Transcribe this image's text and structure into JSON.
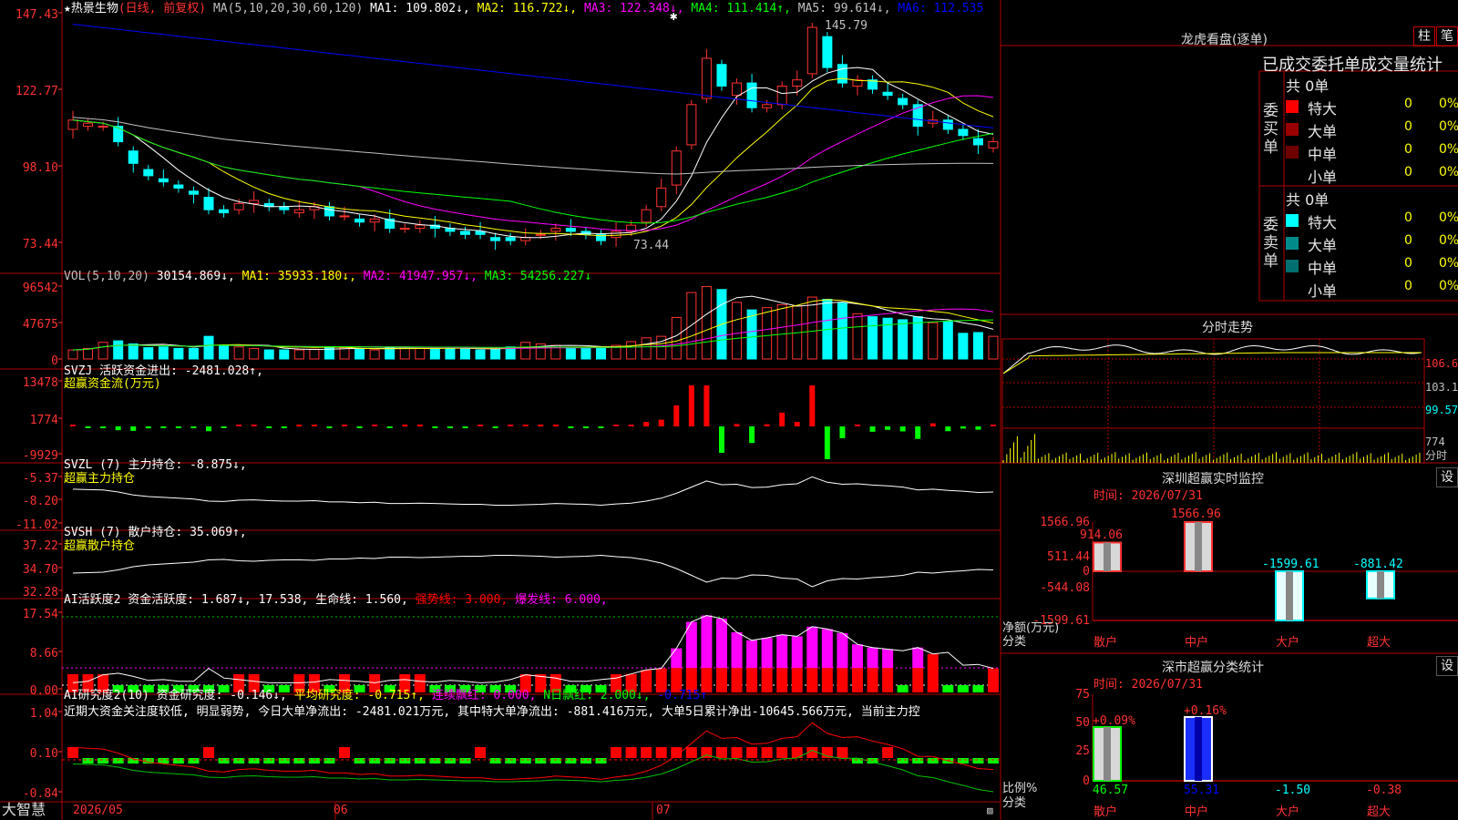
{
  "main": {
    "legend": [
      {
        "t": "★热景生物",
        "c": "#ffffff"
      },
      {
        "t": "(日线, 前复权) ",
        "c": "#ff3232"
      },
      {
        "t": "MA(5,10,20,30,60,120) ",
        "c": "#c0c0c0"
      },
      {
        "t": "MA1: 109.802↓, ",
        "c": "#ffffff"
      },
      {
        "t": "MA2: 116.722↓, ",
        "c": "#ffff00"
      },
      {
        "t": "MA3: 122.348↓, ",
        "c": "#ff00ff"
      },
      {
        "t": "MA4: 111.414↑, ",
        "c": "#00ff00"
      },
      {
        "t": "MA5: 99.614↓, ",
        "c": "#c0c0c0"
      },
      {
        "t": "MA6: 112.535",
        "c": "#0000ff"
      }
    ],
    "yticks": [
      "147.43",
      "122.77",
      "98.10",
      "73.44"
    ],
    "high_label": "145.79",
    "low_label": "73.44"
  },
  "vol": {
    "legend": [
      {
        "t": "VOL(5,10,20) ",
        "c": "#c0c0c0"
      },
      {
        "t": "30154.869↓, ",
        "c": "#ffffff"
      },
      {
        "t": "MA1: 35933.180↓, ",
        "c": "#ffff00"
      },
      {
        "t": "MA2: 41947.957↓, ",
        "c": "#ff00ff"
      },
      {
        "t": "MA3: 54256.227↓",
        "c": "#00ff00"
      }
    ],
    "yticks": [
      "96542",
      "47675",
      "0"
    ]
  },
  "svzj": {
    "legend": [
      {
        "t": "SVZJ  活跃资金进出: ",
        "c": "#ffffff"
      },
      {
        "t": "-2481.028↑,",
        "c": "#ffffff"
      }
    ],
    "sub": "超赢资金流(万元)",
    "yticks": [
      "13478",
      "1774",
      "-9929"
    ]
  },
  "svzl": {
    "legend": [
      {
        "t": "SVZL (7) 主力持仓: -8.875↓,",
        "c": "#ffffff"
      }
    ],
    "sub": "超赢主力持仓",
    "yticks": [
      "-5.37",
      "-8.20",
      "-11.02"
    ]
  },
  "svsh": {
    "legend": [
      {
        "t": "SVSH (7) 散户持仓: 35.069↑,",
        "c": "#ffffff"
      }
    ],
    "sub": "超赢散户持仓",
    "yticks": [
      "37.22",
      "34.70",
      "32.28"
    ]
  },
  "ai1": {
    "legend": [
      {
        "t": "AI活跃度2 资金活跃度: 1.687↓, ",
        "c": "#ffffff"
      },
      {
        "t": "17.538, ",
        "c": "#ffffff"
      },
      {
        "t": "生命线: 1.560, ",
        "c": "#ffffff"
      },
      {
        "t": "强势线: 3.000, ",
        "c": "#ff0000"
      },
      {
        "t": "爆发线: 6.000,",
        "c": "#ff00ff"
      }
    ],
    "yticks": [
      "17.54",
      "8.66",
      "0.00"
    ]
  },
  "ai2": {
    "legend": [
      {
        "t": "AI研究度2(10) 资金研究度: -0.146↓, ",
        "c": "#ffffff"
      },
      {
        "t": "平均研究度: -0.715↑, ",
        "c": "#ffff00"
      },
      {
        "t": "连续飘红: 0.000, ",
        "c": "#ff00ff"
      },
      {
        "t": "N日飘红: 2.000↓, ",
        "c": "#00ff00"
      },
      {
        "t": "-0.715↑",
        "c": "#0000ff"
      }
    ],
    "note": "近期大资金关注度较低, 明显弱势, 今日大单净流出: -2481.021万元, 其中特大单净流出: -881.416万元, 大单5日累计净出-10645.566万元, 当前主力控",
    "yticks": [
      "1.04",
      "0.10",
      "-0.84"
    ]
  },
  "bottom": {
    "brand": "大智慧",
    "months": [
      "2026/05",
      "06",
      "07"
    ]
  },
  "right": {
    "title": "龙虎看盘(逐单)",
    "btn1": "柱",
    "btn2": "笔",
    "tabs": "已成交委托单成交量统计",
    "buy": {
      "label": "委买单",
      "total": "共 0单",
      "rows": [
        {
          "name": "特大",
          "v": "0",
          "p": "0%",
          "c": "#ff0000"
        },
        {
          "name": "大单",
          "v": "0",
          "p": "0%",
          "c": "#9b0000"
        },
        {
          "name": "中单",
          "v": "0",
          "p": "0%",
          "c": "#6e0000"
        },
        {
          "name": "小单",
          "v": "0",
          "p": "0%",
          "c": ""
        }
      ]
    },
    "sell": {
      "label": "委卖单",
      "total": "共 0单",
      "rows": [
        {
          "name": "特大",
          "v": "0",
          "p": "0%",
          "c": "#00ffff"
        },
        {
          "name": "大单",
          "v": "0",
          "p": "0%",
          "c": "#008b8b"
        },
        {
          "name": "中单",
          "v": "0",
          "p": "0%",
          "c": "#007070"
        },
        {
          "name": "小单",
          "v": "0",
          "p": "0%",
          "c": ""
        }
      ]
    },
    "intraday": {
      "title": "分时走势",
      "y": [
        "106.6",
        "103.1",
        "99.57",
        "774",
        "分时"
      ]
    },
    "sz": {
      "title": "深圳超赢实时监控",
      "set": "设",
      "time": "时间: 2026/07/31",
      "y": [
        "1566.96",
        "511.44",
        "0",
        "-544.08",
        "-1599.61"
      ],
      "axis": [
        "净额(万元)",
        "分类"
      ],
      "bars": [
        {
          "cat": "散户",
          "v": 914.06,
          "label": "914.06"
        },
        {
          "cat": "中户",
          "v": 1566.96,
          "label": "1566.96"
        },
        {
          "cat": "大户",
          "v": -1599.61,
          "label": "-1599.61"
        },
        {
          "cat": "超大",
          "v": -881.42,
          "label": "-881.42"
        }
      ]
    },
    "sh": {
      "title": "深市超赢分类统计",
      "set": "设",
      "time": "时间: 2026/07/31",
      "y": [
        "75",
        "50",
        "25",
        "0"
      ],
      "axis": [
        "比例%",
        "分类"
      ],
      "bars": [
        {
          "cat": "散户",
          "v": 46.57,
          "top": "+0.09%",
          "label": "46.57"
        },
        {
          "cat": "中户",
          "v": 55.31,
          "top": "+0.16%",
          "label": "55.31"
        },
        {
          "cat": "大户",
          "v": -1.5,
          "top": "",
          "label": "-1.50"
        },
        {
          "cat": "超大",
          "v": -0.38,
          "top": "",
          "label": "-0.38"
        }
      ]
    }
  },
  "chart_data": {
    "type": "candlestick",
    "xlabel": "",
    "ylabel": "",
    "ylim": [
      73.44,
      147.43
    ],
    "months": [
      "2026/05",
      "06",
      "07"
    ],
    "close": [
      113,
      112,
      111,
      106,
      99,
      95,
      93,
      91,
      89,
      84,
      83,
      86,
      87,
      85,
      84,
      84,
      85,
      82,
      82,
      80,
      81,
      78,
      78,
      79,
      78,
      77,
      76,
      76,
      74,
      74,
      75,
      76,
      78,
      77,
      76,
      74,
      77,
      79,
      84,
      91,
      103,
      118,
      133,
      124,
      125,
      117,
      118,
      124,
      126,
      143,
      130,
      125,
      126,
      123,
      121,
      118,
      111,
      113,
      110,
      108,
      105,
      106
    ],
    "open": [
      110,
      111,
      111,
      111,
      103,
      97,
      94,
      92,
      90,
      88,
      84,
      84,
      86,
      86,
      85,
      83,
      84,
      85,
      82,
      81,
      80,
      81,
      78,
      78,
      79,
      78,
      77,
      77,
      75,
      75,
      74,
      76,
      77,
      78,
      77,
      76,
      75,
      77,
      80,
      85,
      92,
      105,
      120,
      131,
      121,
      125,
      117,
      118,
      124,
      128,
      140,
      131,
      124,
      126,
      122,
      120,
      118,
      112,
      113,
      110,
      107,
      104
    ],
    "volume": [
      12000,
      14000,
      22000,
      24000,
      20000,
      15000,
      16000,
      14000,
      14000,
      30000,
      18000,
      16000,
      14000,
      12000,
      12000,
      12000,
      13000,
      16000,
      15000,
      14000,
      12000,
      15000,
      16000,
      14000,
      13000,
      15000,
      14000,
      12000,
      13000,
      16000,
      22000,
      20000,
      18000,
      14000,
      14000,
      16000,
      18000,
      23000,
      28000,
      30000,
      55000,
      88000,
      96000,
      92000,
      75000,
      65000,
      68000,
      72000,
      70000,
      82000,
      79000,
      74000,
      60000,
      56000,
      54000,
      52000,
      56000,
      48000,
      50000,
      34000,
      35000,
      30000
    ],
    "ma_series": [
      {
        "name": "MA1",
        "color": "#ffffff"
      },
      {
        "name": "MA2",
        "color": "#ffff00"
      },
      {
        "name": "MA3",
        "color": "#ff00ff"
      },
      {
        "name": "MA4",
        "color": "#00ff00"
      },
      {
        "name": "MA5",
        "color": "#c0c0c0"
      },
      {
        "name": "MA6",
        "color": "#0000ff"
      }
    ]
  }
}
